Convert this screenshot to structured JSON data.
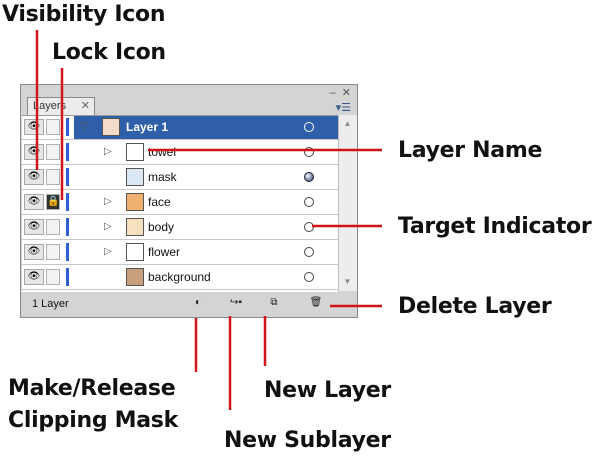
{
  "callouts": {
    "visibility_icon": "Visibility Icon",
    "lock_icon": "Lock Icon",
    "layer_name": "Layer Name",
    "target_indicator": "Target Indicator",
    "delete_layer": "Delete Layer",
    "clipping_mask_line1": "Make/Release",
    "clipping_mask_line2": "Clipping Mask",
    "new_sublayer": "New Sublayer",
    "new_layer": "New Layer"
  },
  "panel": {
    "tab_label": "Layers",
    "layers": [
      {
        "name": "Layer 1",
        "icon": "layer-thumbnail",
        "target": "empty",
        "selected": true
      },
      {
        "name": "towel",
        "icon": "towel-thumbnail",
        "target": "empty"
      },
      {
        "name": "mask",
        "icon": "mask-thumbnail",
        "target": "filled"
      },
      {
        "name": "face",
        "icon": "face-thumbnail",
        "target": "empty"
      },
      {
        "name": "body",
        "icon": "body-thumbnail",
        "target": "empty"
      },
      {
        "name": "flower",
        "icon": "flower-thumbnail",
        "target": "empty"
      },
      {
        "name": "background",
        "icon": "background-thumbnail",
        "target": "empty"
      }
    ],
    "layer_count": "1 Layer",
    "colors": {
      "selection": "#2f5fa8",
      "layer_bar": "#3060d0",
      "leader": "#d0141c"
    }
  }
}
